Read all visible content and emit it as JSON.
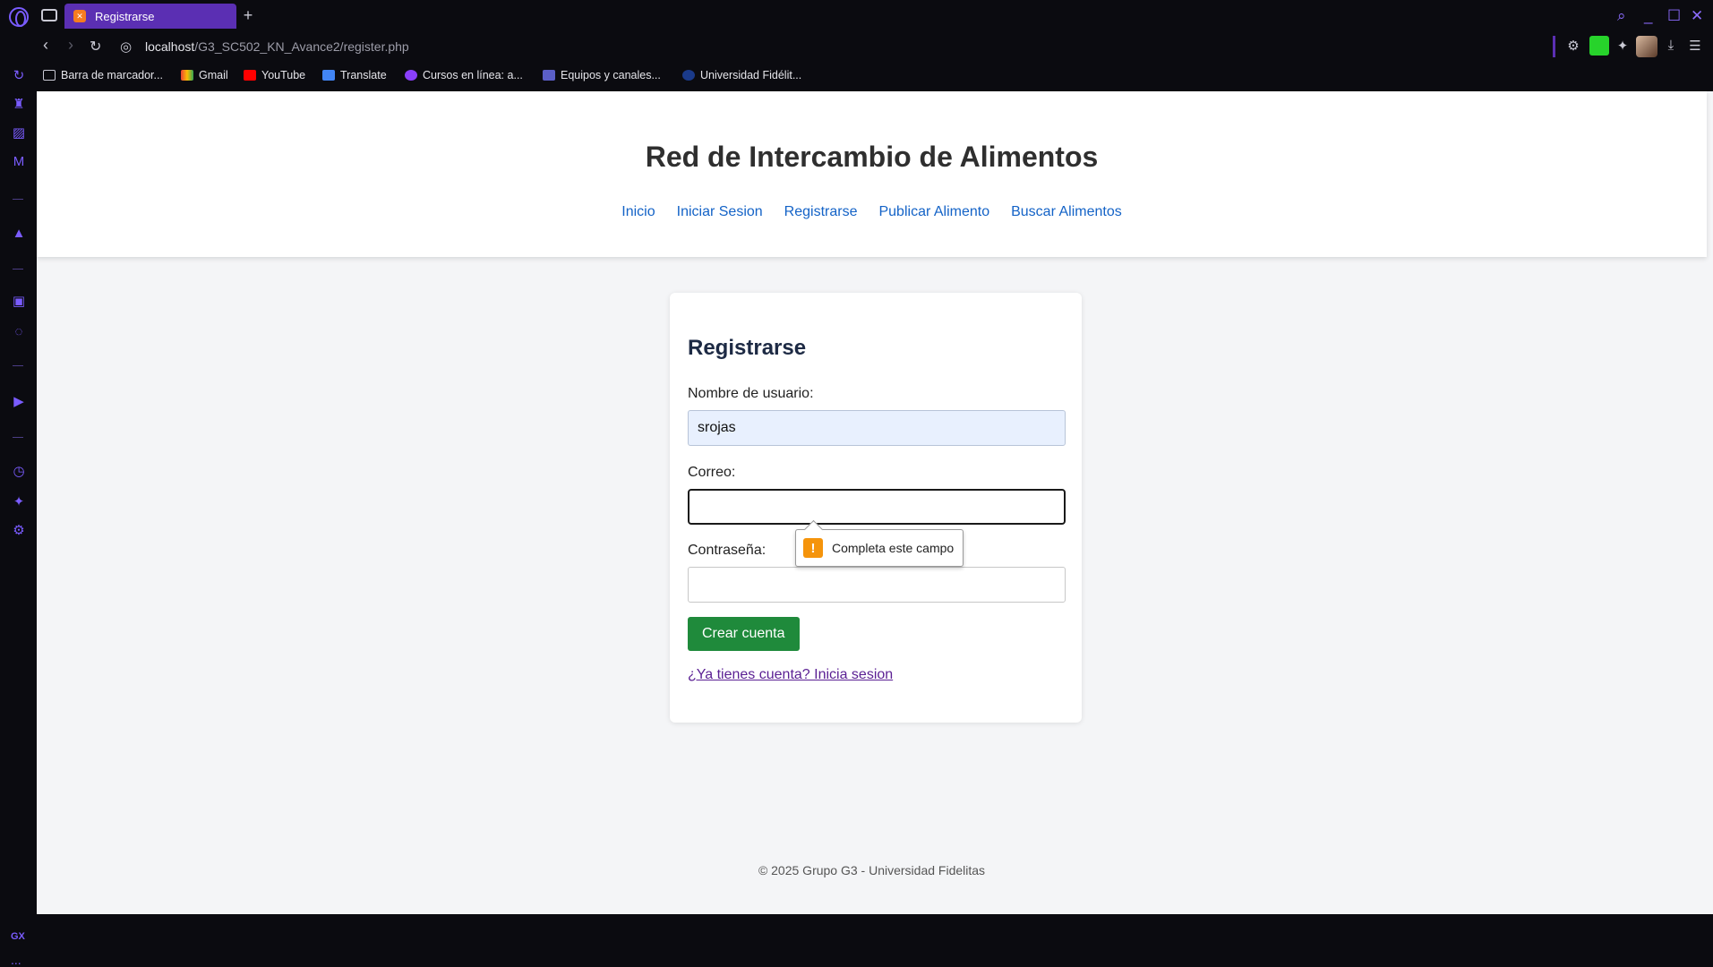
{
  "browser": {
    "tab_title": "Registrarse",
    "new_tab": "+",
    "url_host": "localhost",
    "url_path": "/G3_SC502_KN_Avance2/register.php",
    "bookmarks": [
      {
        "label": "Barra de marcador..."
      },
      {
        "label": "Gmail"
      },
      {
        "label": "YouTube"
      },
      {
        "label": "Translate"
      },
      {
        "label": "Cursos en línea: a..."
      },
      {
        "label": "Equipos y canales..."
      },
      {
        "label": "Universidad Fidélit..."
      }
    ],
    "sidebar_badge": "GX",
    "sidebar_more": "..."
  },
  "site": {
    "title": "Red de Intercambio de Alimentos",
    "nav": [
      "Inicio",
      "Iniciar Sesion",
      "Registrarse",
      "Publicar Alimento",
      "Buscar Alimentos"
    ]
  },
  "form": {
    "heading": "Registrarse",
    "username_label": "Nombre de usuario:",
    "username_value": "srojas",
    "email_label": "Correo:",
    "email_value": "",
    "password_label": "Contraseña:",
    "password_value": "",
    "submit_label": "Crear cuenta",
    "login_link": "¿Ya tienes cuenta? Inicia sesion"
  },
  "validation": {
    "icon": "!",
    "message": "Completa este campo"
  },
  "footer": {
    "text": "© 2025 Grupo G3 - Universidad Fidelitas"
  },
  "colors": {
    "tab_active": "#5b2fb3",
    "link": "#1463c7",
    "submit": "#1f8a3b",
    "warning": "#f5940b"
  }
}
